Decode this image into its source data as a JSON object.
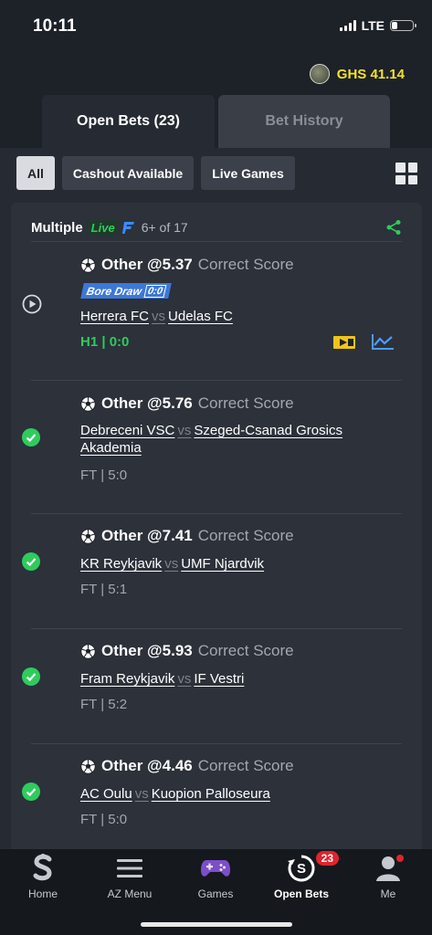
{
  "status_bar": {
    "time": "10:11",
    "network": "LTE"
  },
  "balance": {
    "amount": "GHS 41.14"
  },
  "tabs": [
    {
      "label": "Open Bets (23)",
      "active": true
    },
    {
      "label": "Bet History",
      "active": false
    }
  ],
  "filters": [
    {
      "label": "All",
      "active": true
    },
    {
      "label": "Cashout Available",
      "active": false
    },
    {
      "label": "Live Games",
      "active": false
    }
  ],
  "card": {
    "title": "Multiple",
    "live_label": "Live",
    "count": "6+ of 17"
  },
  "bets": [
    {
      "pick": "Other @5.37",
      "market": "Correct Score",
      "badge": "Bore Draw",
      "badge_score": "0:0",
      "home": "Herrera FC",
      "vs": "vs",
      "away": "Udelas FC",
      "result": "H1 | 0:0",
      "status": "live"
    },
    {
      "pick": "Other @5.76",
      "market": "Correct Score",
      "home": "Debreceni VSC",
      "vs": "vs",
      "away": "Szeged-Csanad Grosics Akademia",
      "result": "FT | 5:0",
      "status": "won"
    },
    {
      "pick": "Other @7.41",
      "market": "Correct Score",
      "home": "KR Reykjavik",
      "vs": "vs",
      "away": "UMF Njardvik",
      "result": "FT | 5:1",
      "status": "won"
    },
    {
      "pick": "Other @5.93",
      "market": "Correct Score",
      "home": "Fram Reykjavik",
      "vs": "vs",
      "away": "IF Vestri",
      "result": "FT | 5:2",
      "status": "won"
    },
    {
      "pick": "Other @4.46",
      "market": "Correct Score",
      "home": "AC Oulu",
      "vs": "vs",
      "away": "Kuopion Palloseura",
      "result": "FT | 5:0",
      "status": "won"
    }
  ],
  "bottom_nav": [
    {
      "label": "Home",
      "icon": "sporty-logo-icon"
    },
    {
      "label": "AZ Menu",
      "icon": "hamburger-icon"
    },
    {
      "label": "Games",
      "icon": "gamepad-icon"
    },
    {
      "label": "Open Bets",
      "icon": "open-bets-icon",
      "badge": "23",
      "active": true
    },
    {
      "label": "Me",
      "icon": "user-icon"
    }
  ],
  "colors": {
    "accent_green": "#2ecc5c",
    "balance_yellow": "#f5e12a",
    "badge_red": "#e0242e",
    "blue": "#3c78d8"
  }
}
